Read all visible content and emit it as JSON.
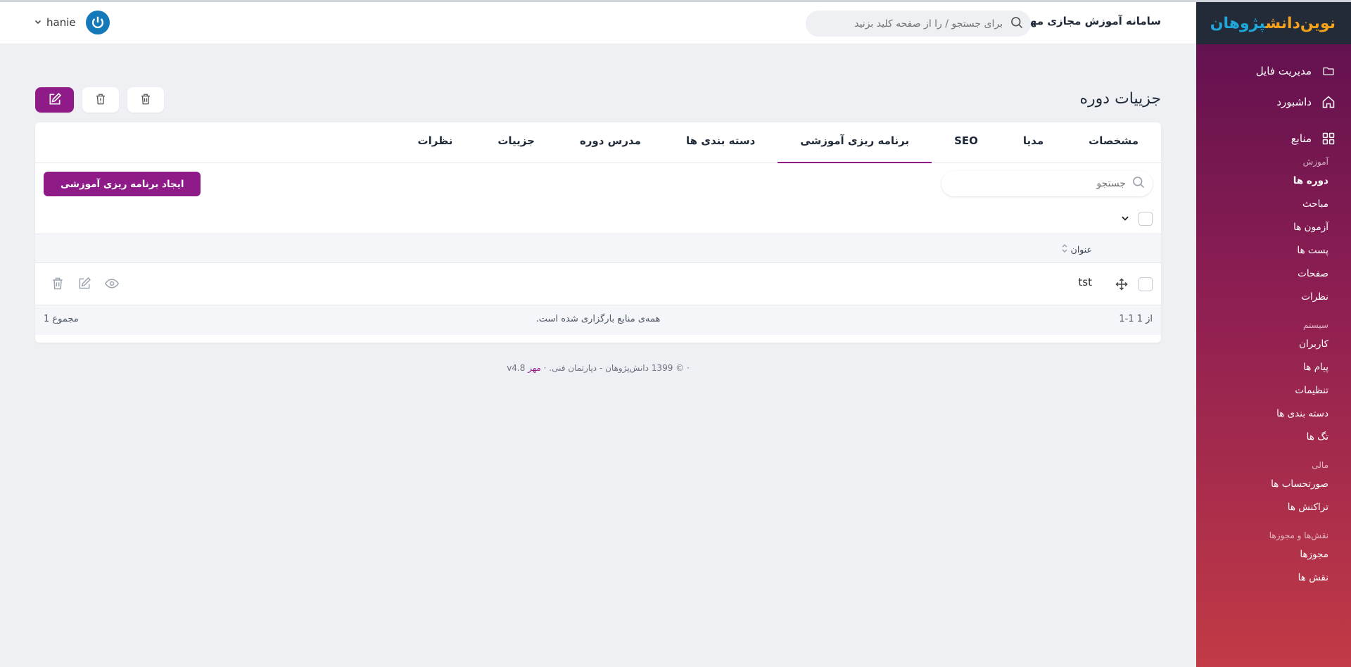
{
  "header": {
    "site_title": "سامانه آموزش مجازی مهر",
    "search_placeholder": "برای جستجو / را از صفحه کلید بزنید",
    "user_name": "hanie"
  },
  "sidebar": {
    "logo_text_a": "نوین‌دانش",
    "logo_text_b": "پژوهان",
    "main_items": [
      {
        "label": "مدیریت فایل",
        "icon": "folder-icon"
      },
      {
        "label": "داشبورد",
        "icon": "home-icon"
      },
      {
        "label": "منابع",
        "icon": "grid-icon"
      }
    ],
    "sections": [
      {
        "title": "آموزش",
        "items": [
          "دوره ها",
          "مباحث",
          "آزمون ها",
          "پست ها",
          "صفحات",
          "نظرات"
        ]
      },
      {
        "title": "سیستم",
        "items": [
          "کاربران",
          "پیام ها",
          "تنظیمات",
          "دسته بندی ها",
          "تگ ها"
        ]
      },
      {
        "title": "مالی",
        "items": [
          "صورتحساب ها",
          "تراکنش ها"
        ]
      },
      {
        "title": "نقش‌ها و مجوزها",
        "items": [
          "مجوزها",
          "نقش ها"
        ]
      }
    ]
  },
  "page": {
    "title": "جزییات دوره"
  },
  "tabs": [
    "مشخصات",
    "مدیا",
    "SEO",
    "برنامه ریزی آموزشی",
    "دسته بندی ها",
    "مدرس دوره",
    "جزییات",
    "نظرات"
  ],
  "active_tab": "برنامه ریزی آموزشی",
  "table": {
    "search_placeholder": "جستجو",
    "create_button": "ایجاد برنامه ریزی آموزشی",
    "column_title": "عنوان",
    "rows": [
      {
        "title": "tst"
      }
    ],
    "pager": "1-1 از 1",
    "loaded_text": "همه‌ی منابع بارگزاری شده است.",
    "total": "مجموع 1"
  },
  "footer": {
    "copyright": "· © 1399 دانش‌پژوهان - دپارتمان فنی.",
    "sep": "·",
    "brand": "مهر",
    "version": "v4.8"
  },
  "colors": {
    "accent": "#8e1b88",
    "sidebar_top": "#5c0f4f",
    "sidebar_bottom": "#c23a45",
    "logo_bar": "#232a38",
    "avatar": "#1479b8"
  }
}
